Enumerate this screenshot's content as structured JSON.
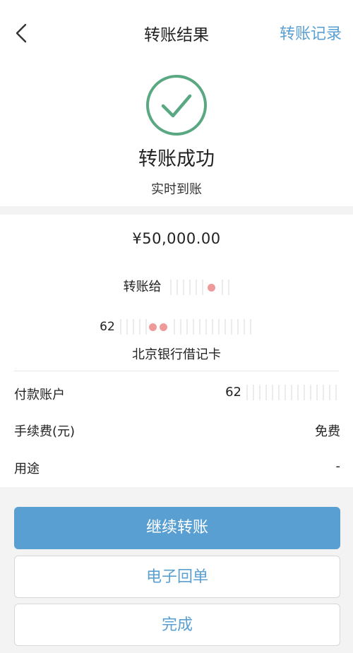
{
  "header": {
    "title": "转账结果",
    "records_link": "转账记录"
  },
  "status": {
    "title": "转账成功",
    "subtitle": "实时到账"
  },
  "transfer": {
    "amount": "¥50,000.00",
    "to_label": "转账给",
    "to_name_visible": "",
    "account_prefix": "62",
    "bank": "北京银行借记卡"
  },
  "details": [
    {
      "label": "付款账户",
      "value": "62"
    },
    {
      "label": "手续费(元)",
      "value": "免费"
    },
    {
      "label": "用途",
      "value": "-"
    }
  ],
  "actions": {
    "continue": "继续转账",
    "receipt": "电子回单",
    "done": "完成"
  },
  "colors": {
    "accent": "#5a9fd2",
    "success": "#5aa882"
  }
}
